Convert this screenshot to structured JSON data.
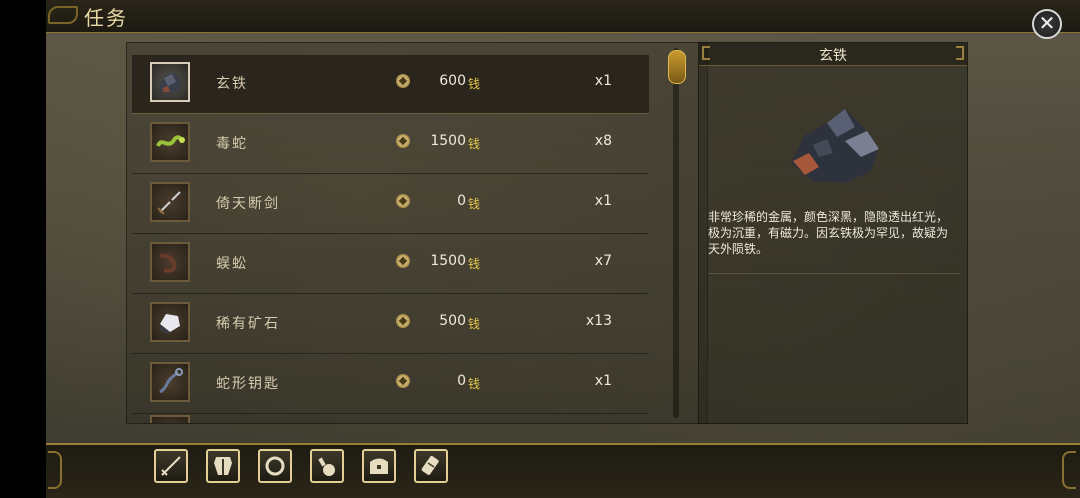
{
  "header": {
    "title": "任务",
    "close_label": "✕"
  },
  "items": [
    {
      "name": "玄铁",
      "price": "600",
      "currency": "钱",
      "qty": "x1",
      "icon": "ore-icon",
      "selected": true
    },
    {
      "name": "毒蛇",
      "price": "1500",
      "currency": "钱",
      "qty": "x8",
      "icon": "snake-icon",
      "selected": false
    },
    {
      "name": "倚天断剑",
      "price": "0",
      "currency": "钱",
      "qty": "x1",
      "icon": "broken-sword-icon",
      "selected": false
    },
    {
      "name": "蜈蚣",
      "price": "1500",
      "currency": "钱",
      "qty": "x7",
      "icon": "centipede-icon",
      "selected": false
    },
    {
      "name": "稀有矿石",
      "price": "500",
      "currency": "钱",
      "qty": "x13",
      "icon": "rare-ore-icon",
      "selected": false
    },
    {
      "name": "蛇形钥匙",
      "price": "0",
      "currency": "钱",
      "qty": "x1",
      "icon": "snake-key-icon",
      "selected": false
    }
  ],
  "detail": {
    "title": "玄铁",
    "description": "非常珍稀的金属，颜色深黑，隐隐透出红光，极为沉重，有磁力。因玄铁极为罕见，故疑为天外陨铁。"
  },
  "toolbar": {
    "buttons": [
      "sword-icon",
      "armor-icon",
      "ring-icon",
      "potion-icon",
      "chest-icon",
      "scroll-icon"
    ]
  }
}
